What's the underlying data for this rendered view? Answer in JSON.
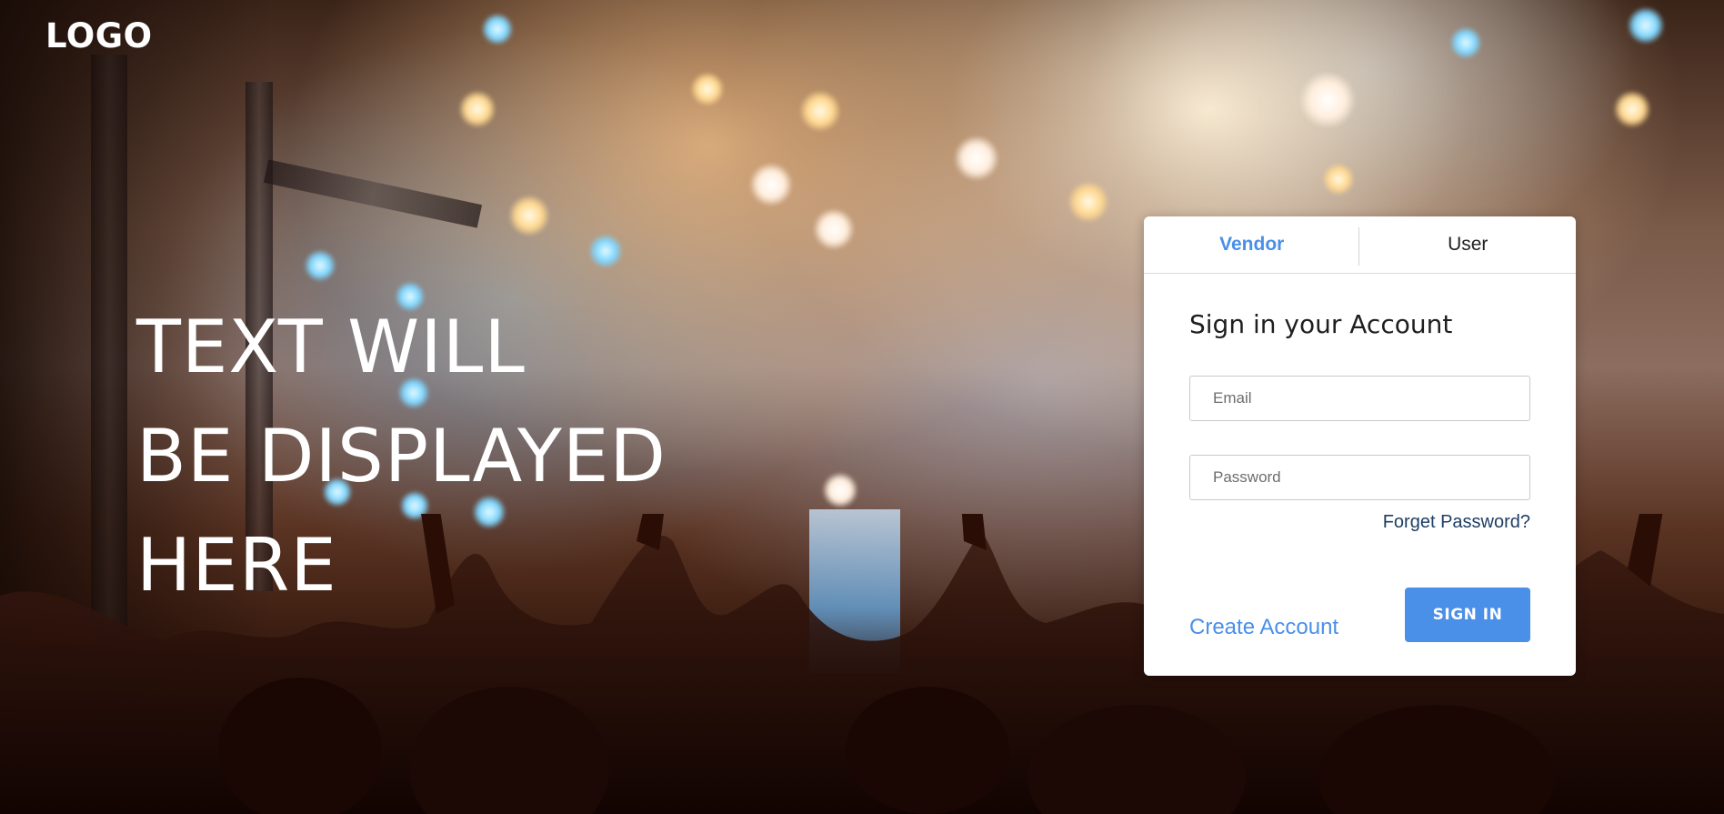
{
  "brand": {
    "logo_text": "LOGO"
  },
  "hero": {
    "lines": [
      "TEXT WILL",
      "BE DISPLAYED",
      "HERE"
    ]
  },
  "login_card": {
    "tabs": [
      {
        "label": "Vendor",
        "active": true
      },
      {
        "label": "User",
        "active": false
      }
    ],
    "title": "Sign in your Account",
    "email_placeholder": "Email",
    "password_placeholder": "Password",
    "forgot_label": "Forget Password?",
    "create_label": "Create Account",
    "signin_label": "SIGN IN"
  },
  "colors": {
    "accent": "#4a8fe8",
    "link_dark": "#1d3f64",
    "card_bg": "#ffffff",
    "text_light": "#ffffff"
  },
  "background": {
    "description_icon": "concert-crowd-image"
  }
}
